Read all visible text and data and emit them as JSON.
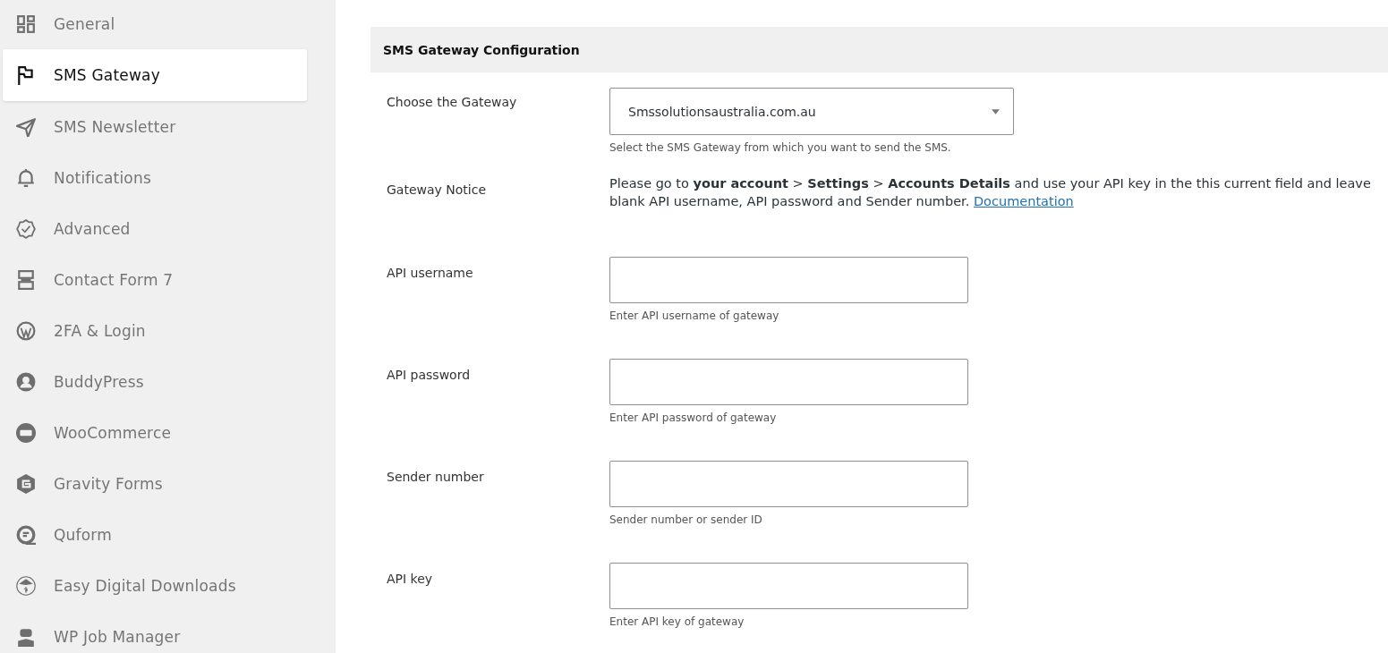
{
  "sidebar": {
    "items": [
      {
        "label": "General",
        "selected": false
      },
      {
        "label": "SMS Gateway",
        "selected": true
      },
      {
        "label": "SMS Newsletter",
        "selected": false
      },
      {
        "label": "Notifications",
        "selected": false
      },
      {
        "label": "Advanced",
        "selected": false
      },
      {
        "label": "Contact Form 7",
        "selected": false
      },
      {
        "label": "2FA & Login",
        "selected": false
      },
      {
        "label": "BuddyPress",
        "selected": false
      },
      {
        "label": "WooCommerce",
        "selected": false
      },
      {
        "label": "Gravity Forms",
        "selected": false
      },
      {
        "label": "Quform",
        "selected": false
      },
      {
        "label": "Easy Digital Downloads",
        "selected": false
      },
      {
        "label": "WP Job Manager",
        "selected": false
      }
    ]
  },
  "section": {
    "title": "SMS Gateway Configuration",
    "rows": [
      {
        "kind": "select",
        "label": "Choose the Gateway",
        "value": "Smssolutionsaustralia.com.au",
        "help": "Select the SMS Gateway from which you want to send the SMS."
      },
      {
        "kind": "notice",
        "label": "Gateway Notice",
        "text": "Please go to **your account** > **Settings** > **Accounts Details** and use your API key in the this current field and leave blank API username, API password and Sender number.",
        "link": "Documentation"
      },
      {
        "kind": "input",
        "label": "API username",
        "help": "Enter API username of gateway"
      },
      {
        "kind": "input",
        "label": "API password",
        "help": "Enter API password of gateway"
      },
      {
        "kind": "input",
        "label": "Sender number",
        "help": "Sender number or sender ID"
      },
      {
        "kind": "input",
        "label": "API key",
        "help": "Enter API key of gateway"
      }
    ]
  }
}
